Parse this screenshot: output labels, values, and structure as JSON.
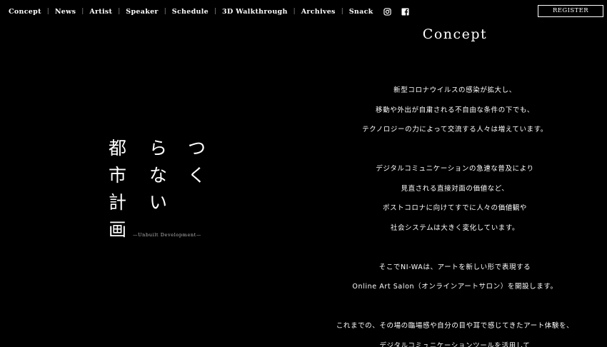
{
  "nav": {
    "items": [
      {
        "label": "Concept"
      },
      {
        "label": "News"
      },
      {
        "label": "Artist"
      },
      {
        "label": "Speaker"
      },
      {
        "label": "Schedule"
      },
      {
        "label": "3D Walkthrough"
      },
      {
        "label": "Archives"
      },
      {
        "label": "Snack"
      }
    ],
    "separator": "|",
    "icons": [
      "instagram-icon",
      "facebook-icon"
    ],
    "register_label": "REGISTER"
  },
  "title": {
    "columns": [
      [
        "都",
        "市",
        "計",
        "画"
      ],
      [
        "ら",
        "な",
        "い"
      ],
      [
        "つ",
        "く"
      ]
    ],
    "subtitle": "—Unbuilt Development—"
  },
  "concept": {
    "heading": "Concept",
    "lines": [
      "新型コロナウイルスの感染が拡大し、",
      "移動や外出が自粛される不自由な条件の下でも、",
      "テクノロジーの力によって交流する人々は増えています。",
      "",
      "デジタルコミュニケーションの急速な普及により",
      "見直される直接対面の価値など、",
      "ポストコロナに向けてすでに人々の価値観や",
      "社会システムは大きく変化しています。",
      "",
      "そこでNI-WAは、アートを新しい形で表現する",
      "Online Art Salon（オンラインアートサロン）を開設します。",
      "",
      "これまでの、その場の臨場感や自分の目や耳で感じてきたアート体験を、",
      "デジタルコミュニケーションツールを活用して"
    ]
  },
  "colors": {
    "background": "#000000",
    "text": "#ffffff",
    "separator": "#888888"
  }
}
